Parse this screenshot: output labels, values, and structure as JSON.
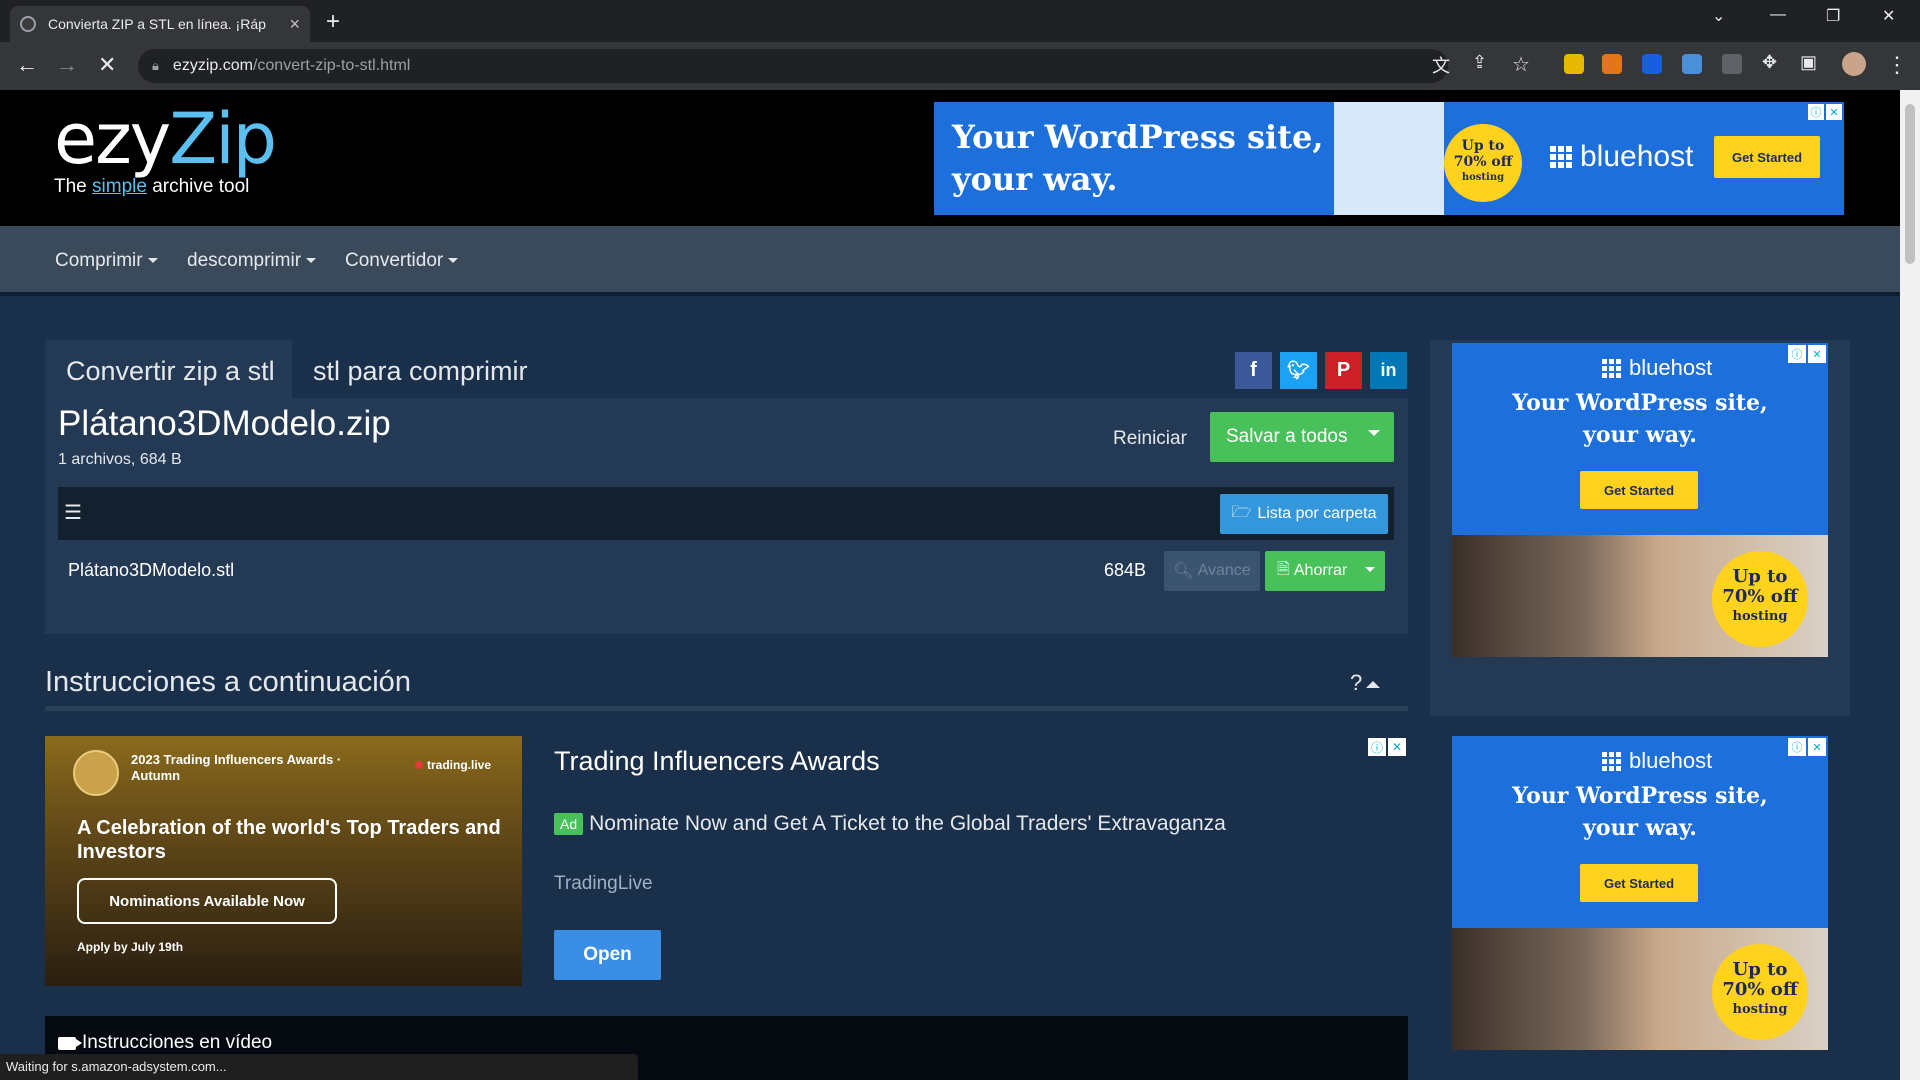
{
  "browser": {
    "tab_title": "Convierta ZIP a STL en línea. ¡Ráp",
    "url_host": "ezyzip.com",
    "url_path": "/convert-zip-to-stl.html",
    "status_text": "Waiting for s.amazon-adsystem.com..."
  },
  "site": {
    "logo_ezy": "ezy",
    "logo_zip": "Zip",
    "tagline_pre": "The ",
    "tagline_simple": "simple",
    "tagline_post": " archive tool",
    "nav": [
      "Comprimir",
      "descomprimir",
      "Convertidor"
    ]
  },
  "banner_ad": {
    "headline_line1": "Your WordPress site,",
    "headline_line2": "your way.",
    "badge_line1": "Up to",
    "badge_line2": "70% off",
    "badge_line3": "hosting",
    "brand": "bluehost",
    "cta": "Get Started"
  },
  "tool": {
    "tab_active": "Convertir zip a stl",
    "tab_inactive": "stl para comprimir",
    "file_title": "Plátano3DModelo.zip",
    "file_meta": "1 archivos, 684 B",
    "reset_label": "Reiniciar",
    "save_all_label": "Salvar a todos",
    "folder_list_label": "Lista por carpeta",
    "files": [
      {
        "name": "Plátano3DModelo.stl",
        "size": "684B",
        "preview": "Avance",
        "save": "Ahorrar"
      }
    ]
  },
  "instructions": {
    "title": "Instrucciones a continuación",
    "toggle": "?"
  },
  "native_ad": {
    "img_header": "2023 Trading Influencers Awards · Autumn",
    "img_brand": "trading.live",
    "img_headline": "A Celebration of the world's Top Traders and Investors",
    "img_cta": "Nominations Available Now",
    "img_footer": "Apply by July 19th",
    "title": "Trading Influencers Awards",
    "badge": "Ad",
    "description": "Nominate Now and Get A Ticket to the Global Traders' Extravaganza",
    "advertiser": "TradingLive",
    "cta": "Open"
  },
  "video": {
    "title": "Instrucciones en vídeo"
  },
  "side_ads": [
    {
      "brand": "bluehost",
      "line1": "Your WordPress site,",
      "line2": "your way.",
      "cta": "Get Started",
      "badge1": "Up to",
      "badge2": "70% off",
      "badge3": "hosting"
    },
    {
      "brand": "bluehost",
      "line1": "Your WordPress site,",
      "line2": "your way.",
      "cta": "Get Started",
      "badge1": "Up to",
      "badge2": "70% off",
      "badge3": "hosting"
    }
  ],
  "colors": {
    "page_bg": "#1a2f4a",
    "panel_bg": "#243a54",
    "accent_green": "#48c15a",
    "accent_blue": "#3497db",
    "bluehost_blue": "#1d6fdc",
    "bluehost_yellow": "#ffd21e"
  }
}
